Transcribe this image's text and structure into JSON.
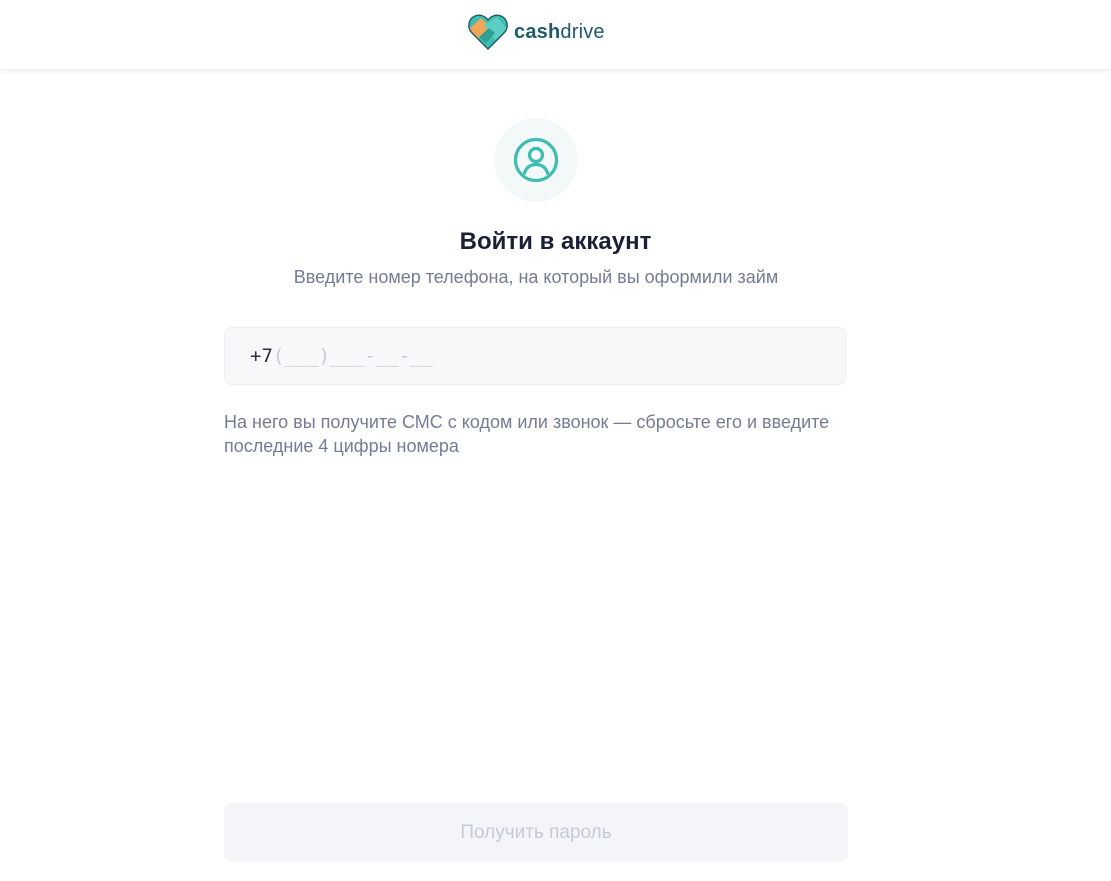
{
  "brand": {
    "name_bold": "cash",
    "name_light": "drive",
    "accent_color": "#3dbcb0",
    "text_color": "#1f5a66"
  },
  "header": {
    "logo_icon": "handshake-heart-icon"
  },
  "login": {
    "avatar_icon": "user-circle-icon",
    "title": "Войти в аккаунт",
    "subtitle": "Введите номер телефона, на который вы оформили займ",
    "phone": {
      "prefix": "+7",
      "value": "",
      "placeholder": "(___)___-__-__"
    },
    "hint": "На него вы получите СМС с кодом или звонок — сбросьте его и введите последние 4 цифры номера",
    "submit_label": "Получить пароль",
    "submit_enabled": false
  }
}
